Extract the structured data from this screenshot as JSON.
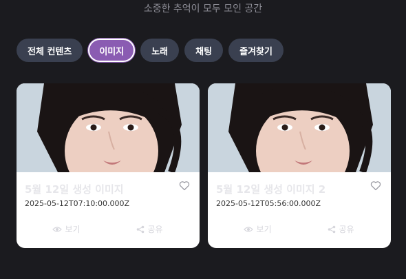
{
  "header": {
    "subtitle": "소중한 추억이 모두 모인 공간"
  },
  "tabs": [
    {
      "label": "전체 컨텐츠",
      "active": false
    },
    {
      "label": "이미지",
      "active": true
    },
    {
      "label": "노래",
      "active": false
    },
    {
      "label": "채팅",
      "active": false
    },
    {
      "label": "즐겨찾기",
      "active": false
    }
  ],
  "cards": [
    {
      "title": "5월 12일 생성 이미지",
      "date": "2025-05-12T07:10:00.000Z",
      "view_label": "보기",
      "share_label": "공유",
      "favorite_icon": "heart-outline-icon"
    },
    {
      "title": "5월 12일 생성 이미지 2",
      "date": "2025-05-12T05:56:00.000Z",
      "view_label": "보기",
      "share_label": "공유",
      "favorite_icon": "heart-outline-icon"
    }
  ],
  "colors": {
    "background": "#1b1b1f",
    "tab": "#3a4050",
    "tab_active": "#8a5cb2"
  }
}
